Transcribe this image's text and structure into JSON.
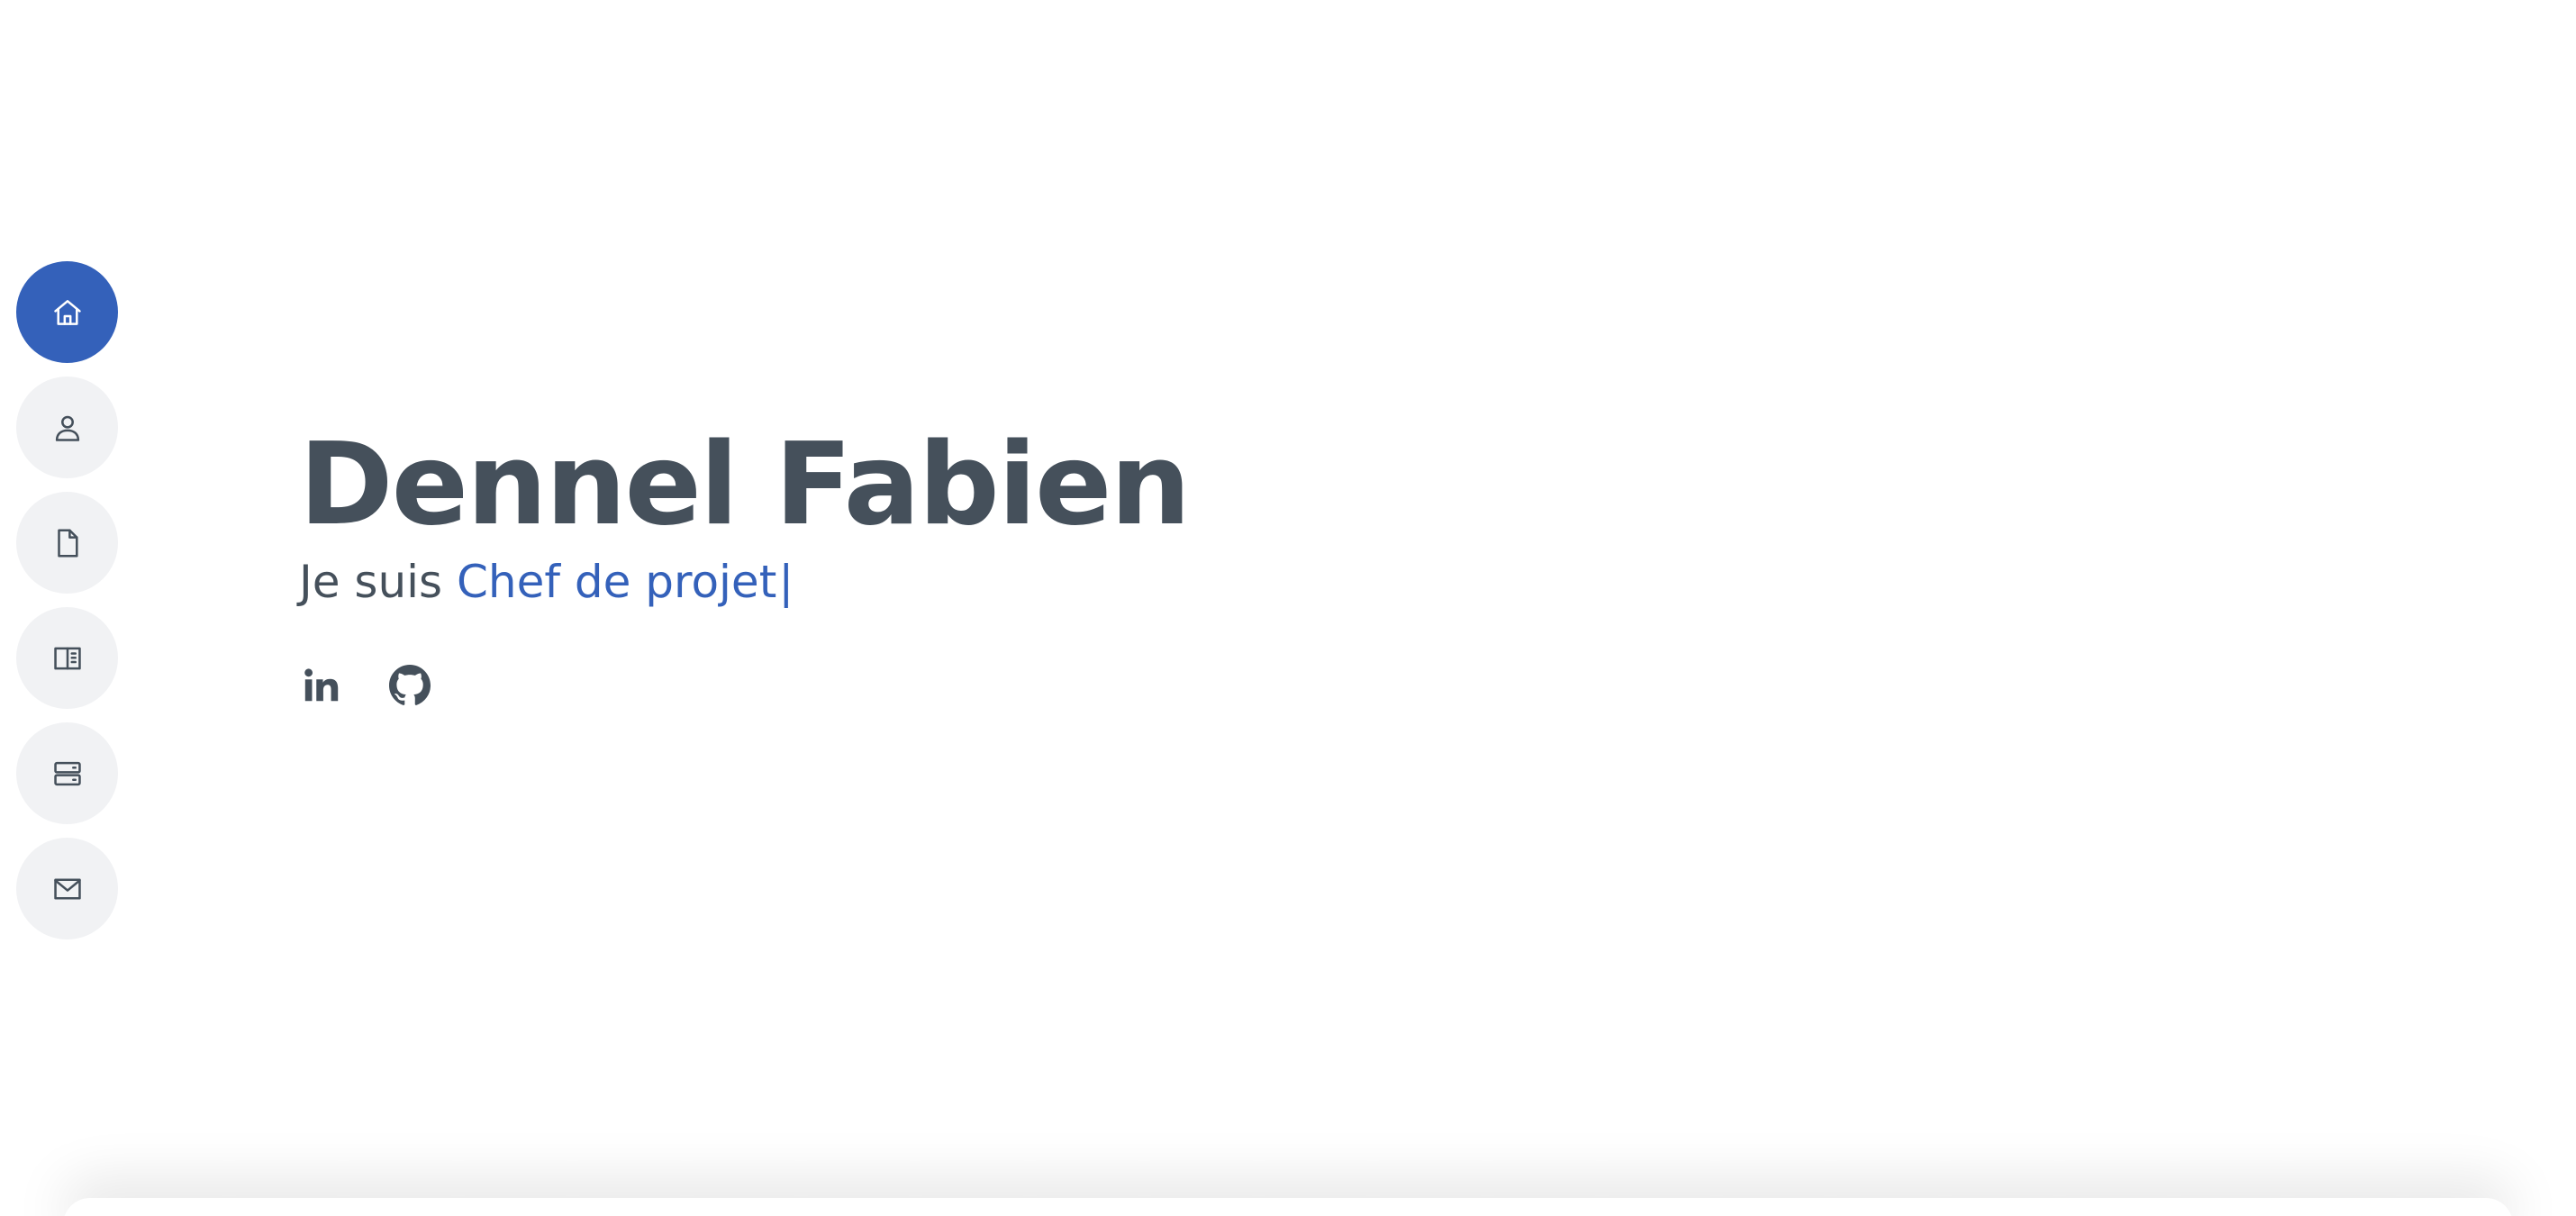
{
  "colors": {
    "accent": "#3461ba",
    "text": "#45505b",
    "nav_background": "#f1f2f4",
    "page_background": "#ffffff"
  },
  "nav": {
    "items": [
      {
        "icon": "home-icon",
        "active": true
      },
      {
        "icon": "person-icon",
        "active": false
      },
      {
        "icon": "file-icon",
        "active": false
      },
      {
        "icon": "book-half-icon",
        "active": false
      },
      {
        "icon": "server-icon",
        "active": false
      },
      {
        "icon": "envelope-icon",
        "active": false
      }
    ]
  },
  "hero": {
    "name": "Dennel Fabien",
    "intro": "Je suis",
    "role": "Chef de projet",
    "cursor": "|"
  },
  "socials": [
    {
      "icon": "linkedin-icon"
    },
    {
      "icon": "github-icon"
    }
  ]
}
